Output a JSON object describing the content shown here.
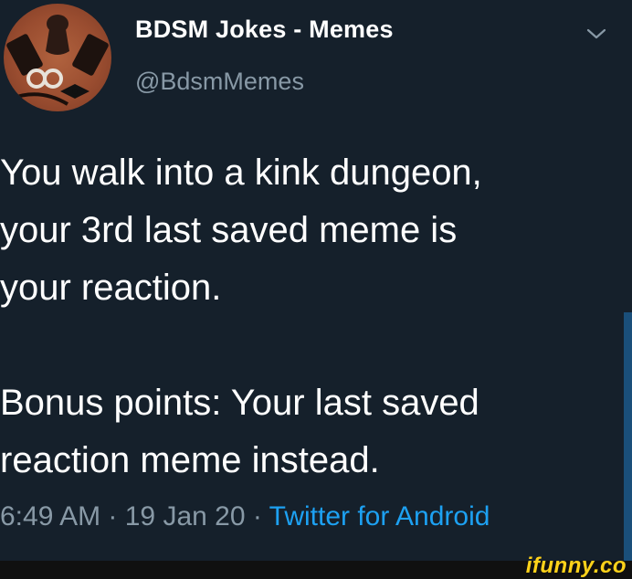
{
  "tweet": {
    "display_name": "BDSM Jokes - Memes",
    "handle": "@BdsmMemes",
    "body": {
      "line1": "You walk into a kink dungeon,",
      "line2": "your 3rd last saved meme is",
      "line3": "your reaction.",
      "line4": "Bonus points: Your last saved",
      "line5": "reaction meme instead."
    },
    "time": "6:49 AM",
    "separator": " · ",
    "date": "19 Jan 20",
    "source": "Twitter for Android",
    "menu_icon": "chevron-down-icon"
  },
  "watermark": {
    "text": "ifunny.co"
  },
  "colors": {
    "background": "#15202b",
    "text": "#ffffff",
    "secondary_text": "#8899a6",
    "link": "#1da1f2",
    "watermark": "#ffd21a"
  }
}
